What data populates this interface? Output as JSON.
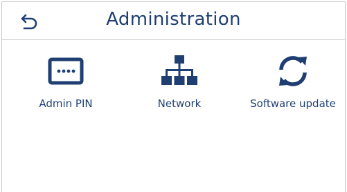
{
  "header": {
    "title": "Administration",
    "back_icon": "back-arrow-icon"
  },
  "colors": {
    "primary": "#1f3f73",
    "border": "#cfcfcf",
    "background": "#ffffff"
  },
  "tiles": [
    {
      "label": "Admin PIN",
      "icon": "pin-keypad-icon"
    },
    {
      "label": "Network",
      "icon": "network-icon"
    },
    {
      "label": "Software update",
      "icon": "refresh-icon"
    }
  ]
}
